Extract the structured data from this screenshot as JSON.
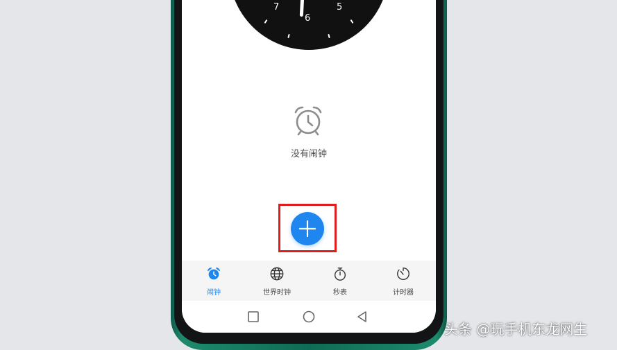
{
  "clock": {
    "numbers": [
      "7",
      "6",
      "5"
    ]
  },
  "empty_state": {
    "icon": "alarm-clock-icon",
    "text": "没有闹钟"
  },
  "fab": {
    "icon": "plus-icon"
  },
  "tabs": [
    {
      "label": "闹钟",
      "icon": "alarm-clock-icon",
      "active": true
    },
    {
      "label": "世界时钟",
      "icon": "globe-icon",
      "active": false
    },
    {
      "label": "秒表",
      "icon": "stopwatch-icon",
      "active": false
    },
    {
      "label": "计时器",
      "icon": "timer-icon",
      "active": false
    }
  ],
  "navbar": [
    "square-icon",
    "circle-icon",
    "triangle-back-icon"
  ],
  "watermark": "头条 @玩手机东龙网生",
  "colors": {
    "accent": "#1f86f0",
    "highlight": "#e01d1d",
    "phone_frame": "#1d8a6c"
  }
}
